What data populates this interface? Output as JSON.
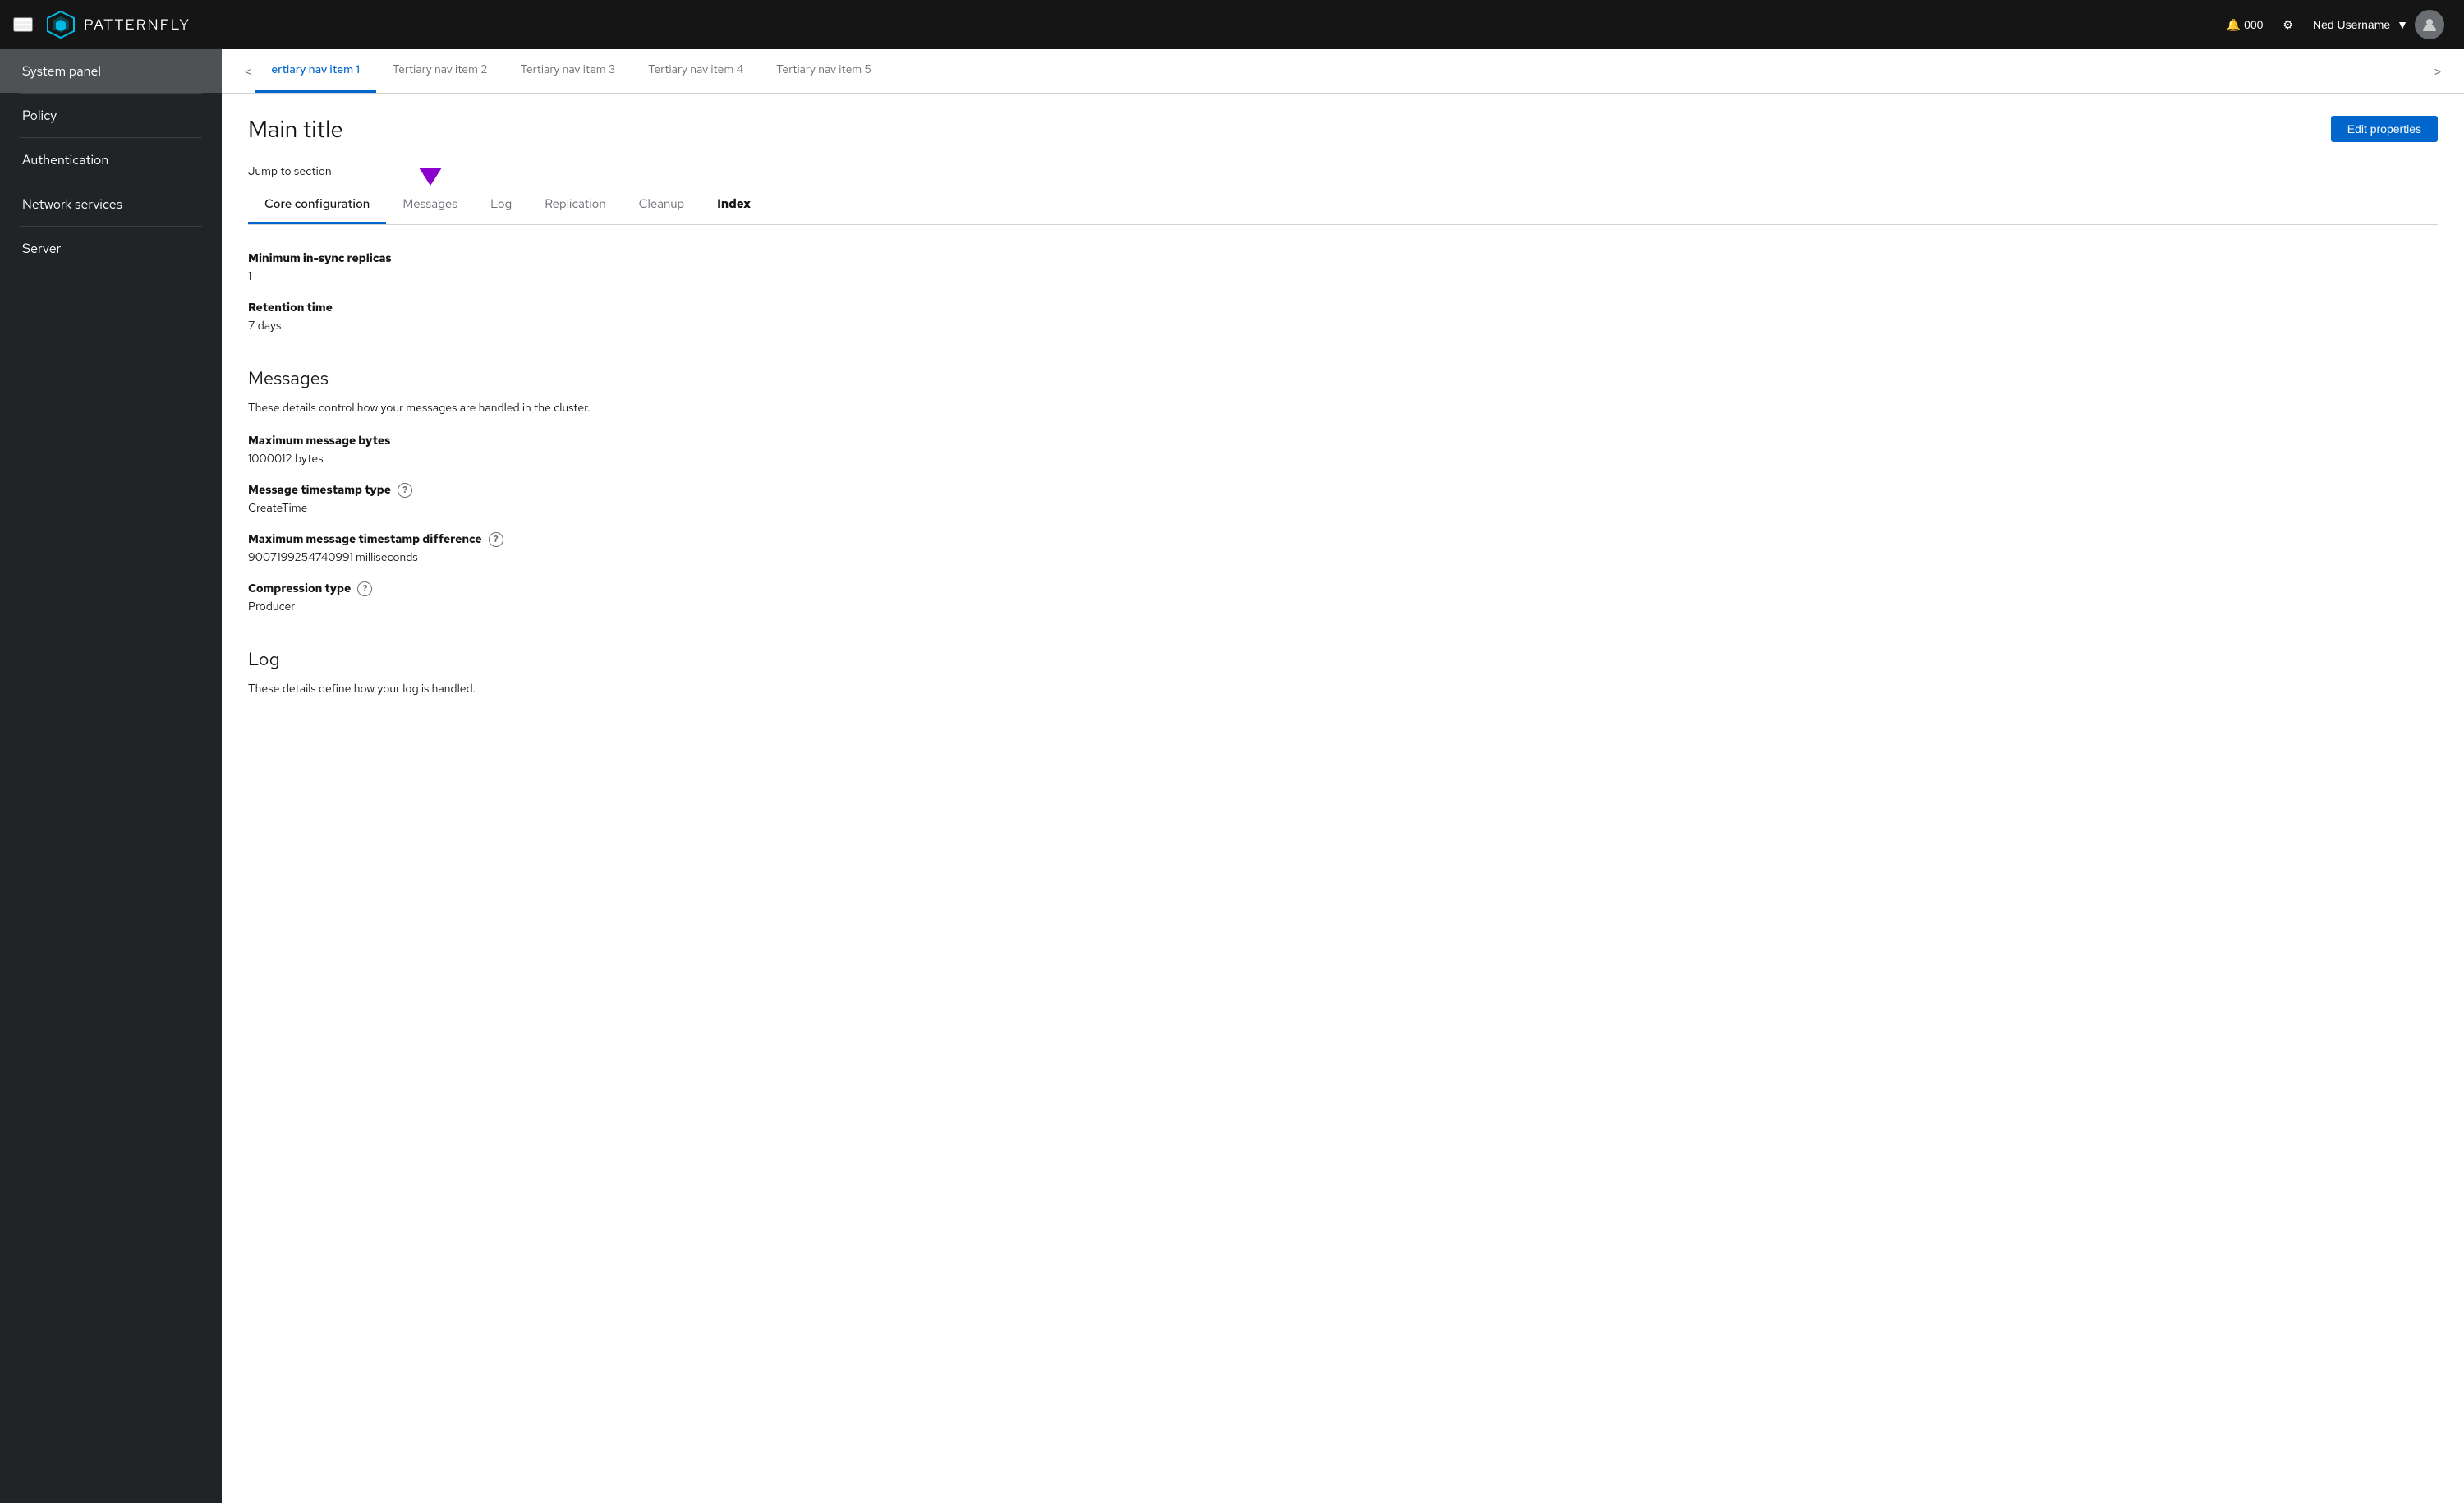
{
  "topnav": {
    "brand_name": "PATTERNFLY",
    "notification_count": "000",
    "username": "Ned Username"
  },
  "sidebar": {
    "items": [
      {
        "id": "system-panel",
        "label": "System panel",
        "active": true
      },
      {
        "id": "policy",
        "label": "Policy",
        "active": false
      },
      {
        "id": "authentication",
        "label": "Authentication",
        "active": false
      },
      {
        "id": "network-services",
        "label": "Network services",
        "active": false
      },
      {
        "id": "server",
        "label": "Server",
        "active": false
      }
    ]
  },
  "tertiary_nav": {
    "prev_label": "<",
    "next_label": ">",
    "items": [
      {
        "id": "tertiary-1",
        "label": "ertiary nav item 1",
        "active": true
      },
      {
        "id": "tertiary-2",
        "label": "Tertiary nav item 2",
        "active": false
      },
      {
        "id": "tertiary-3",
        "label": "Tertiary nav item 3",
        "active": false
      },
      {
        "id": "tertiary-4",
        "label": "Tertiary nav item 4",
        "active": false
      },
      {
        "id": "tertiary-5",
        "label": "Tertiary nav item 5",
        "active": false
      }
    ]
  },
  "page": {
    "title": "Main title",
    "edit_button": "Edit properties",
    "jump_label": "Jump to section"
  },
  "tabs": {
    "items": [
      {
        "id": "core-config",
        "label": "Core configuration",
        "active": true
      },
      {
        "id": "messages",
        "label": "Messages",
        "active": false
      },
      {
        "id": "log",
        "label": "Log",
        "active": false
      },
      {
        "id": "replication",
        "label": "Replication",
        "active": false
      },
      {
        "id": "cleanup",
        "label": "Cleanup",
        "active": false
      },
      {
        "id": "index",
        "label": "Index",
        "active": false
      }
    ]
  },
  "core_config": {
    "fields": [
      {
        "label": "Minimum in-sync replicas",
        "value": "1",
        "help": false
      },
      {
        "label": "Retention time",
        "value": "7 days",
        "help": false
      }
    ]
  },
  "messages_section": {
    "title": "Messages",
    "description": "These details control how your messages are handled in the cluster.",
    "fields": [
      {
        "label": "Maximum message bytes",
        "value": "1000012 bytes",
        "help": false
      },
      {
        "label": "Message timestamp type",
        "value": "CreateTime",
        "help": true
      },
      {
        "label": "Maximum message timestamp difference",
        "value": "9007199254740991 milliseconds",
        "help": true
      },
      {
        "label": "Compression type",
        "value": "Producer",
        "help": true
      }
    ]
  },
  "log_section": {
    "title": "Log",
    "description": "These details define how your log is handled."
  }
}
